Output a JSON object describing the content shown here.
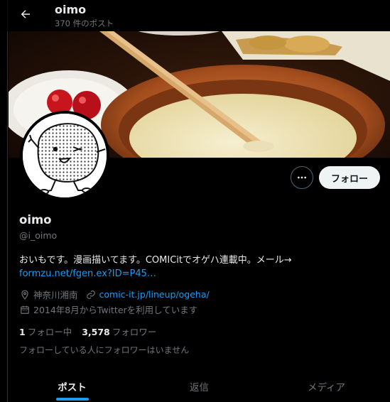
{
  "header": {
    "title": "oimo",
    "post_count": "370 件のポスト"
  },
  "profile": {
    "display_name": "oimo",
    "handle": "@i_oimo",
    "bio_text": "おいもです。漫画描いてます。COMICitでオゲハ連載中。メール→",
    "bio_link": "formzu.net/fgen.ex?ID=P45…",
    "location": "神奈川湘南",
    "website": "comic-it.jp/lineup/ogeha/",
    "joined": "2014年8月からTwitterを利用しています",
    "following_count": "1",
    "following_label": "フォロー中",
    "followers_count": "3,578",
    "followers_label": "フォロワー",
    "followed_by_note": "フォローしている人にフォロワーはいません"
  },
  "actions": {
    "more_icon": "more-horizontal-icon",
    "follow_label": "フォロー"
  },
  "tabs": [
    {
      "label": "ポスト",
      "active": true
    },
    {
      "label": "返信",
      "active": false
    },
    {
      "label": "メディア",
      "active": false
    }
  ],
  "colors": {
    "background": "#000000",
    "accent": "#1d9bf0",
    "text_primary": "#e7e9ea",
    "text_secondary": "#71767b",
    "follow_button_bg": "#eff3f4"
  },
  "icons": {
    "back": "arrow-left-icon",
    "location": "location-pin-icon",
    "link": "link-icon",
    "calendar": "calendar-icon"
  }
}
